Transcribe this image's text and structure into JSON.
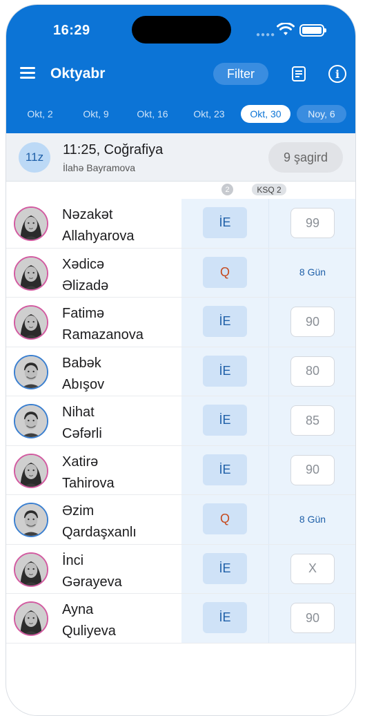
{
  "status_bar": {
    "time": "16:29"
  },
  "header": {
    "title": "Oktyabr",
    "filter_label": "Filter"
  },
  "date_tabs": [
    {
      "label": "Okt, 2"
    },
    {
      "label": "Okt, 9"
    },
    {
      "label": "Okt, 16"
    },
    {
      "label": "Okt, 23"
    },
    {
      "label": "Okt, 30",
      "active": true
    },
    {
      "label": "Noy, 6"
    }
  ],
  "lesson": {
    "class": "11z",
    "title": "11:25, Coğrafiya",
    "teacher": "İlahə Bayramova",
    "students": "9 şagird"
  },
  "columns": {
    "count": "2",
    "ksq": "KSQ 2"
  },
  "students": [
    {
      "first": "Nəzakət",
      "last": "Allahyarova",
      "mark": "İE",
      "score": "99"
    },
    {
      "first": "Xədicə",
      "last": "Əlizadə",
      "mark": "Q",
      "score": "8 Gün"
    },
    {
      "first": "Fatimə",
      "last": "Ramazanova",
      "mark": "İE",
      "score": "90"
    },
    {
      "first": "Babək",
      "last": "Abışov",
      "mark": "İE",
      "score": "80"
    },
    {
      "first": "Nihat",
      "last": "Cəfərli",
      "mark": "İE",
      "score": "85"
    },
    {
      "first": "Xatirə",
      "last": "Tahirova",
      "mark": "İE",
      "score": "90"
    },
    {
      "first": "Əzim",
      "last": "Qardaşxanlı",
      "mark": "Q",
      "score": "8 Gün"
    },
    {
      "first": "İnci",
      "last": "Gərayeva",
      "mark": "İE",
      "score": "X"
    },
    {
      "first": "Ayna",
      "last": "Quliyeva",
      "mark": "İE",
      "score": "90"
    }
  ],
  "colors": {
    "header_blue": "#0c74d6",
    "absent_mark": "#c54a1e",
    "female_ring": "#d25aa0",
    "male_ring": "#3a7fd0"
  }
}
